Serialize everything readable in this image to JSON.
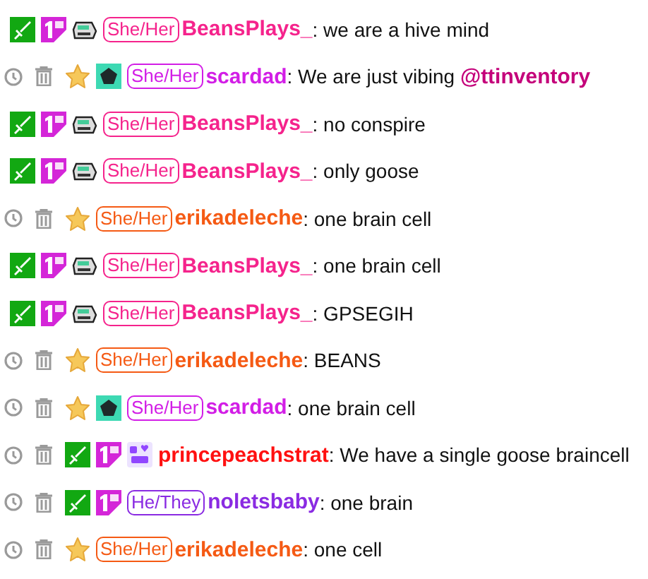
{
  "messages": [
    {
      "mod_actions": false,
      "badges": [
        {
          "kind": "sword"
        },
        {
          "kind": "first"
        },
        {
          "kind": "machine"
        }
      ],
      "pronouns": "She/Her",
      "user": "BeansPlays_",
      "color": "#f5238c",
      "text": ": we are a hive mind"
    },
    {
      "mod_actions": true,
      "badges": [
        {
          "kind": "star"
        },
        {
          "kind": "pentagon"
        }
      ],
      "pronouns": "She/Her",
      "user": "scardad",
      "color": "#d21ee6",
      "text": ": We are just vibing ",
      "mention": "@ttinventory"
    },
    {
      "mod_actions": false,
      "badges": [
        {
          "kind": "sword"
        },
        {
          "kind": "first"
        },
        {
          "kind": "machine"
        }
      ],
      "pronouns": "She/Her",
      "user": "BeansPlays_",
      "color": "#f5238c",
      "text": ": no conspire"
    },
    {
      "mod_actions": false,
      "badges": [
        {
          "kind": "sword"
        },
        {
          "kind": "first"
        },
        {
          "kind": "machine"
        }
      ],
      "pronouns": "She/Her",
      "user": "BeansPlays_",
      "color": "#f5238c",
      "text": ": only goose"
    },
    {
      "mod_actions": true,
      "badges": [
        {
          "kind": "star"
        }
      ],
      "pronouns": "She/Her",
      "user": "erikadeleche",
      "color": "#f55a14",
      "text": ": one brain cell"
    },
    {
      "mod_actions": false,
      "badges": [
        {
          "kind": "sword"
        },
        {
          "kind": "first"
        },
        {
          "kind": "machine"
        }
      ],
      "pronouns": "She/Her",
      "user": "BeansPlays_",
      "color": "#f5238c",
      "text": ": one brain cell"
    },
    {
      "mod_actions": false,
      "badges": [
        {
          "kind": "sword"
        },
        {
          "kind": "first"
        },
        {
          "kind": "machine"
        }
      ],
      "pronouns": "She/Her",
      "user": "BeansPlays_",
      "color": "#f5238c",
      "text": ": GPSEGIH"
    },
    {
      "mod_actions": true,
      "badges": [
        {
          "kind": "star"
        }
      ],
      "pronouns": "She/Her",
      "user": "erikadeleche",
      "color": "#f55a14",
      "text": ": BEANS"
    },
    {
      "mod_actions": true,
      "badges": [
        {
          "kind": "star"
        },
        {
          "kind": "pentagon"
        }
      ],
      "pronouns": "She/Her",
      "user": "scardad",
      "color": "#d21ee6",
      "text": ": one brain cell"
    },
    {
      "mod_actions": true,
      "badges": [
        {
          "kind": "sword"
        },
        {
          "kind": "first"
        },
        {
          "kind": "gift"
        }
      ],
      "user": "princepeachstrat",
      "color": "#ff1010",
      "text": ": We have a single goose braincell"
    },
    {
      "mod_actions": true,
      "badges": [
        {
          "kind": "sword"
        },
        {
          "kind": "first"
        }
      ],
      "pronouns": "He/They",
      "user": "noletsbaby",
      "color": "#8a2be2",
      "text": ": one brain"
    },
    {
      "mod_actions": true,
      "badges": [
        {
          "kind": "star"
        }
      ],
      "pronouns": "She/Her",
      "user": "erikadeleche",
      "color": "#f55a14",
      "text": ": one cell"
    }
  ]
}
